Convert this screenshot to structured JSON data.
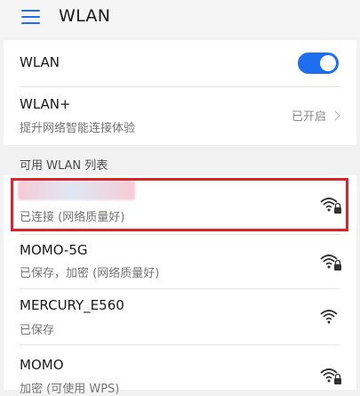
{
  "header": {
    "title": "WLAN",
    "menu_icon": "menu-icon"
  },
  "wlan_toggle": {
    "label": "WLAN",
    "state": "on",
    "color": "#1e6ff0"
  },
  "wlan_plus": {
    "label": "WLAN+",
    "subtitle": "提升网络智能连接体验",
    "status": "已开启"
  },
  "list_header": "可用 WLAN 列表",
  "networks": [
    {
      "ssid": "",
      "status": "已连接 (网络质量好)",
      "secured": true,
      "icon": "wifi-lock-icon"
    },
    {
      "ssid": "MOMO-5G",
      "status": "已保存，加密 (网络质量好)",
      "secured": true,
      "icon": "wifi-lock-icon"
    },
    {
      "ssid": "MERCURY_E560",
      "status": "已保存",
      "secured": false,
      "icon": "wifi-icon"
    },
    {
      "ssid": "MOMO",
      "status": "加密 (可使用 WPS)",
      "secured": true,
      "icon": "wifi-lock-icon"
    }
  ],
  "highlight_color": "#d9232d"
}
